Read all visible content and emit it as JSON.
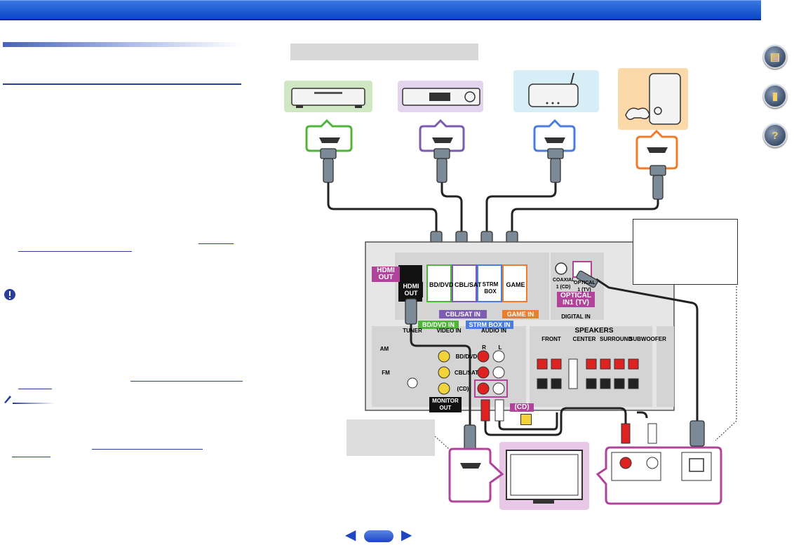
{
  "labels": {
    "hdmi_out": "HDMI OUT",
    "hdmi_out_panel": "HDMI OUT",
    "bd_dvd_port": "BD/DVD",
    "cbl_sat_port": "CBL/SAT",
    "strm_box_port": "STRM BOX",
    "game_port": "GAME",
    "bd_dvd_in": "BD/DVD IN",
    "cbl_sat_in": "CBL/SAT IN",
    "strm_box_in": "STRM BOX IN",
    "game_in": "GAME IN",
    "optical_in": "OPTICAL IN1 (TV)",
    "coaxial_port": "COAXIAL 1 (CD)",
    "optical_port": "OPTICAL 1 (TV)",
    "digital_in": "DIGITAL IN",
    "cd_tag": "(CD)",
    "speakers": "SPEAKERS",
    "front": "FRONT",
    "center": "CENTER",
    "surround": "SURROUND",
    "subwoofer": "SUBWOOFER",
    "video_in": "VIDEO IN",
    "audio_in": "AUDIO IN",
    "tuner": "TUNER",
    "am": "AM",
    "fm": "FM",
    "bd_dvd_rca": "BD/DVD",
    "cbl_sat_rca": "CBL/SAT",
    "cd_rca": "(CD)",
    "monitor_out": "MONITOR OUT",
    "r": "R",
    "l": "L"
  },
  "colors": {
    "header": "#0b46c8",
    "bd_dvd": "#4fb43a",
    "cbl_sat": "#7b5cb0",
    "strm_box": "#4a7de0",
    "game": "#ef7c2a",
    "hdmi_out": "#b0449b",
    "magenta": "#b0449b"
  },
  "icons": [
    "book-icon",
    "remote-icon",
    "help-icon"
  ]
}
